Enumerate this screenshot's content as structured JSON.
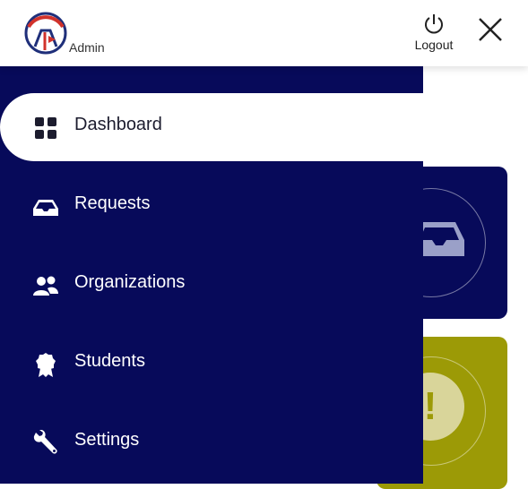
{
  "header": {
    "role_label": "Admin",
    "logout_label": "Logout"
  },
  "sidebar": {
    "items": [
      {
        "label": "Dashboard",
        "icon": "dashboard-grid-icon",
        "active": true
      },
      {
        "label": "Requests",
        "icon": "inbox-icon",
        "active": false
      },
      {
        "label": "Organizations",
        "icon": "people-icon",
        "active": false
      },
      {
        "label": "Students",
        "icon": "award-badge-icon",
        "active": false
      },
      {
        "label": "Settings",
        "icon": "wrench-icon",
        "active": false
      }
    ]
  },
  "colors": {
    "sidebar": "#070a5a",
    "requests_card": "#070a5a",
    "alert_card": "#9c9a06",
    "logo_red": "#d1322b",
    "logo_blue": "#1f2f7a"
  }
}
